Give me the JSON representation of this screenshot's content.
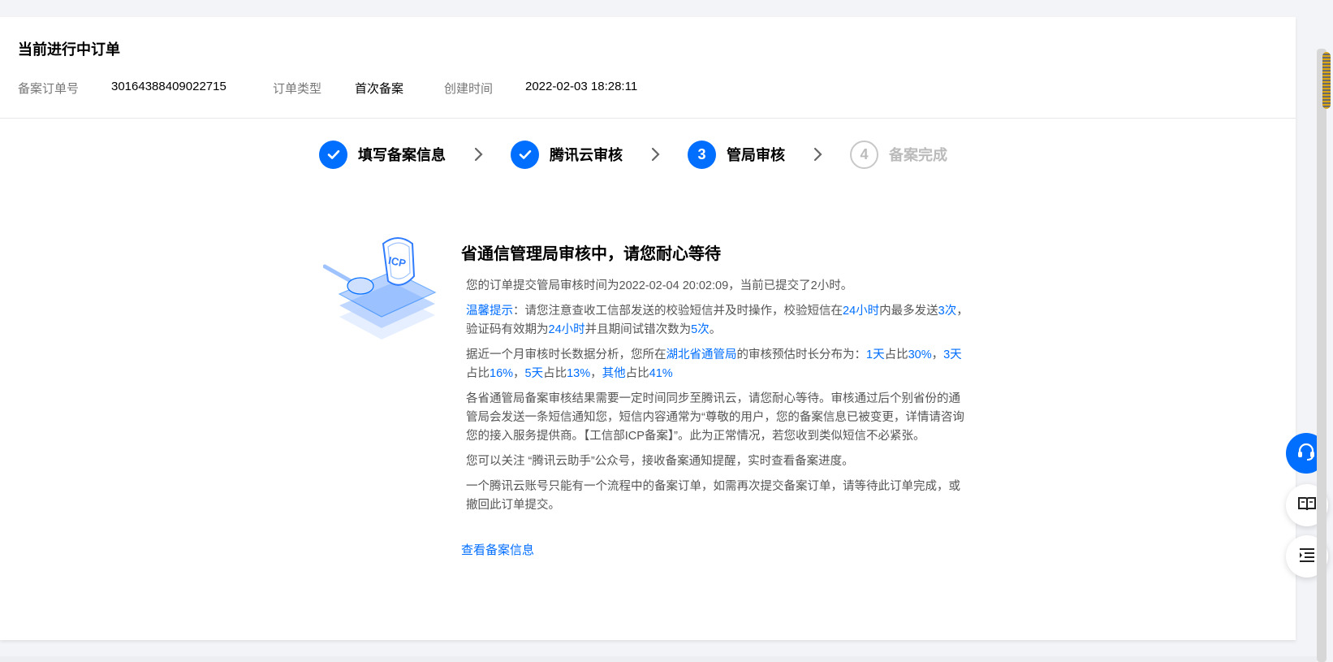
{
  "order": {
    "title": "当前进行中订单",
    "order_no_label": "备案订单号",
    "order_no_value": "30164388409022715",
    "type_label": "订单类型",
    "type_value": "首次备案",
    "created_label": "创建时间",
    "created_value": "2022-02-03 18:28:11"
  },
  "steps": [
    {
      "label": "填写备案信息",
      "status": "done",
      "icon": "check-icon"
    },
    {
      "label": "腾讯云审核",
      "status": "done",
      "icon": "check-icon"
    },
    {
      "label": "管局审核",
      "status": "current",
      "number": "3"
    },
    {
      "label": "备案完成",
      "status": "pending",
      "number": "4"
    }
  ],
  "illustration": {
    "badge_text": "ICP"
  },
  "content": {
    "headline": "省通信管理局审核中，请您耐心等待",
    "p1": "您的订单提交管局审核时间为2022-02-04 20:02:09，当前已提交了2小时。",
    "p2": {
      "tip_label": "温馨提示",
      "a": "：请您注意查收工信部发送的校验短信并及时操作，校验短信在",
      "b": "24小时",
      "c": "内最多发送",
      "d": "3次",
      "e": "，验证码有效期为",
      "f": "24小时",
      "g": "并且期间试错次数为",
      "h": "5次",
      "i": "。"
    },
    "p3": {
      "a": "据近一个月审核时长数据分析，您所在",
      "b": "湖北省通管局",
      "c": "的审核预估时长分布为：",
      "d": "1天",
      "e": "占比",
      "f": "30%",
      "g": "，",
      "h": "3天",
      "i": "占比",
      "j": "16%",
      "k": "，",
      "l": "5天",
      "m": "占比",
      "n": "13%",
      "o": "，",
      "p": "其他",
      "q": "占比",
      "r": "41%"
    },
    "p4": "各省通管局备案审核结果需要一定时间同步至腾讯云，请您耐心等待。审核通过后个别省份的通管局会发送一条短信通知您，短信内容通常为“尊敬的用户，您的备案信息已被变更，详情请咨询您的接入服务提供商。【工信部ICP备案】”。此为正常情况，若您收到类似短信不必紧张。",
    "p5": "您可以关注 “腾讯云助手”公众号，接收备案通知提醒，实时查看备案进度。",
    "p6": "一个腾讯云账号只能有一个流程中的备案订单，如需再次提交备案订单，请等待此订单完成，或撤回此订单提交。",
    "link": "查看备案信息"
  },
  "float_buttons": [
    {
      "icon": "headset-icon"
    },
    {
      "icon": "book-icon"
    },
    {
      "icon": "list-indent-icon"
    }
  ],
  "colors": {
    "accent": "#006eff",
    "pending": "#bbbbbb"
  }
}
